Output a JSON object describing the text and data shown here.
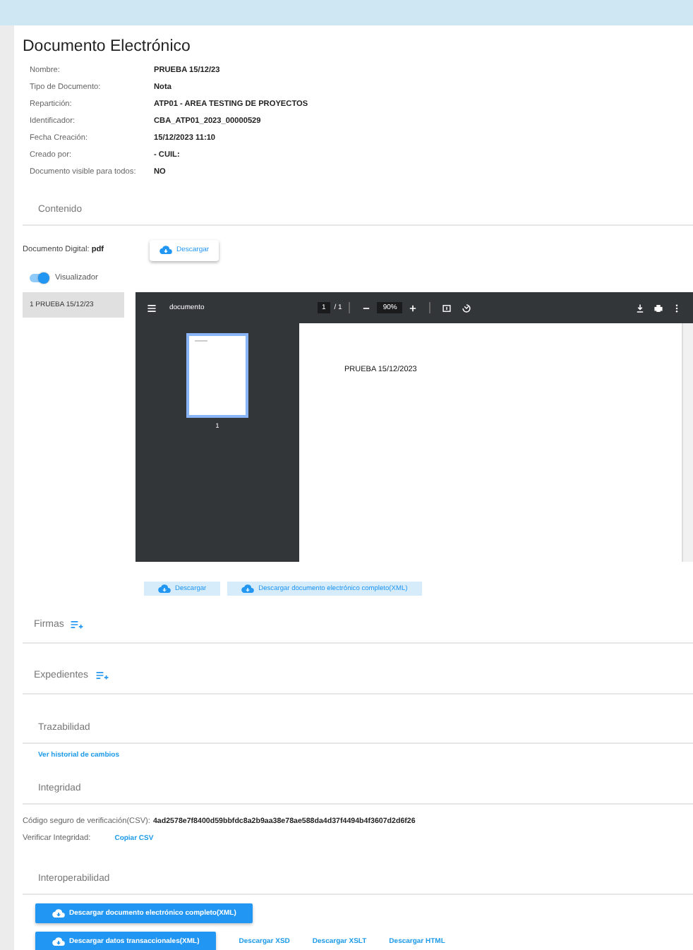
{
  "title": "Documento Electrónico",
  "fields": [
    {
      "label": "Nombre:",
      "value": "PRUEBA 15/12/23"
    },
    {
      "label": "Tipo de Documento:",
      "value": "Nota"
    },
    {
      "label": "Repartición:",
      "value": "ATP01 - AREA TESTING DE PROYECTOS"
    },
    {
      "label": "Identificador:",
      "value": "CBA_ATP01_2023_00000529"
    },
    {
      "label": "Fecha Creación:",
      "value": "15/12/2023 11:10"
    },
    {
      "label": "Creado por:",
      "value": "- CUIL:"
    },
    {
      "label": "Documento visible para todos:",
      "value": "NO"
    }
  ],
  "contenido": {
    "title": "Contenido",
    "digital_label": "Documento Digital:",
    "digital_format": "pdf",
    "download_button": "Descargar",
    "toggle": {
      "label": "Visualizador",
      "on": true
    }
  },
  "attachments": [
    {
      "label": "1 PRUEBA 15/12/23",
      "selected": true
    }
  ],
  "viewer": {
    "title": "documento",
    "page": "1",
    "page_total": "/ 1",
    "zoom": "90%",
    "thumbnail_label": "1",
    "page_text": "PRUEBA 15/12/2023"
  },
  "viewer_buttons": [
    "Descargar",
    "Descargar documento electrónico completo(XML)"
  ],
  "firmas": {
    "title": "Firmas"
  },
  "expedientes": {
    "title": "Expedientes"
  },
  "trazabilidad": {
    "title": "Trazabilidad",
    "link": "Ver historial de cambios"
  },
  "integridad": {
    "title": "Integridad",
    "csv_label": "Código seguro de verificación(CSV):",
    "csv_value": "4ad2578e7f8400d59bbfdc8a2b9aa38e78ae588da4d37f4494b4f3607d2d6f26",
    "verify_label": "Verificar Integridad:",
    "verify_link": "Copiar CSV"
  },
  "interoperabilidad": {
    "title": "Interoperabilidad",
    "primary_buttons": [
      "Descargar documento electrónico completo(XML)",
      "Descargar datos transaccionales(XML)"
    ],
    "links": [
      "Descargar XSD",
      "Descargar XSLT",
      "Descargar HTML"
    ]
  }
}
